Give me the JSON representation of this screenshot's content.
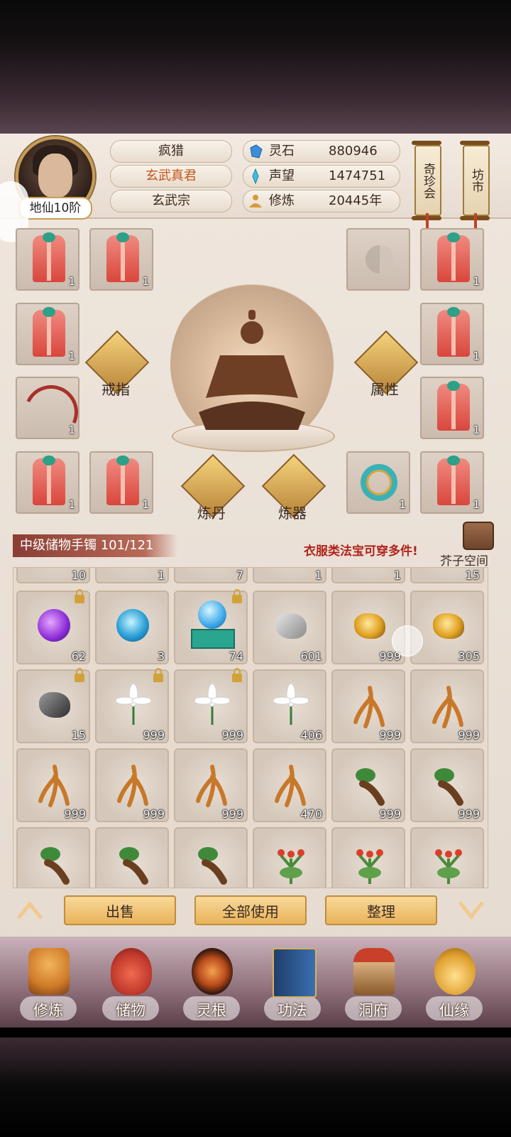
{
  "player": {
    "rank": "地仙10阶",
    "name": "疯猎",
    "title": "玄武真君",
    "sect": "玄武宗"
  },
  "resources": [
    {
      "icon": "spirit-stone-icon",
      "label": "灵石",
      "value": "880946",
      "color": "#3a8fd8"
    },
    {
      "icon": "reputation-icon",
      "label": "声望",
      "value": "1474751",
      "color": "#3ac0e0"
    },
    {
      "icon": "cultivation-icon",
      "label": "修炼",
      "value": "20445年",
      "color": "#d99a3a"
    }
  ],
  "top_scrolls": [
    "奇珍会",
    "坊市"
  ],
  "equipment": {
    "left_slots": [
      {
        "item": "red-robe",
        "count": "1"
      },
      {
        "item": "red-robe",
        "count": "1"
      },
      {
        "item": "red-robe",
        "count": "1"
      },
      {
        "item": "bow",
        "count": "1"
      },
      {
        "item": "red-robe",
        "count": "1"
      },
      {
        "item": "red-robe",
        "count": "1"
      }
    ],
    "right_slots": [
      {
        "item": "empty",
        "count": ""
      },
      {
        "item": "red-robe",
        "count": "1"
      },
      {
        "item": "red-robe",
        "count": "1"
      },
      {
        "item": "red-robe",
        "count": "1"
      },
      {
        "item": "jade-ring",
        "count": "1"
      },
      {
        "item": "red-robe",
        "count": "1"
      }
    ],
    "buttons": {
      "ring": "戒指",
      "attributes": "属性",
      "alchemy": "炼丹",
      "forging": "炼器"
    }
  },
  "bag": {
    "title": "中级储物手镯 101/121",
    "tip": "衣服类法宝可穿多件!",
    "space_label": "芥子空间",
    "partial_row_counts": [
      "10",
      "1",
      "7",
      "1",
      "1",
      "15"
    ],
    "rows": [
      [
        {
          "item": "purple-orb",
          "count": "62",
          "locked": true
        },
        {
          "item": "blue-orb",
          "count": "3",
          "locked": false
        },
        {
          "item": "jade-pedestal-orb",
          "count": "74",
          "locked": true
        },
        {
          "item": "silver-ore",
          "count": "601",
          "locked": false
        },
        {
          "item": "gold-ore",
          "count": "999",
          "locked": false
        },
        {
          "item": "gold-ore",
          "count": "305",
          "locked": false
        }
      ],
      [
        {
          "item": "dark-ore",
          "count": "15",
          "locked": true
        },
        {
          "item": "white-lily",
          "count": "999",
          "locked": true
        },
        {
          "item": "white-lily",
          "count": "999",
          "locked": true
        },
        {
          "item": "white-lily",
          "count": "406",
          "locked": false
        },
        {
          "item": "ginseng-root",
          "count": "999",
          "locked": false
        },
        {
          "item": "ginseng-root",
          "count": "999",
          "locked": false
        }
      ],
      [
        {
          "item": "ginseng-root",
          "count": "999",
          "locked": false
        },
        {
          "item": "ginseng-root",
          "count": "999",
          "locked": false
        },
        {
          "item": "ginseng-root",
          "count": "999",
          "locked": false
        },
        {
          "item": "ginseng-root",
          "count": "470",
          "locked": false
        },
        {
          "item": "leaf-tuber",
          "count": "999",
          "locked": false
        },
        {
          "item": "leaf-tuber",
          "count": "999",
          "locked": false
        }
      ],
      [
        {
          "item": "leaf-tuber",
          "count": "",
          "locked": false
        },
        {
          "item": "leaf-tuber",
          "count": "",
          "locked": false
        },
        {
          "item": "leaf-tuber",
          "count": "",
          "locked": false
        },
        {
          "item": "red-flower-herb",
          "count": "",
          "locked": false
        },
        {
          "item": "red-flower-herb",
          "count": "",
          "locked": false
        },
        {
          "item": "red-flower-herb",
          "count": "",
          "locked": false
        }
      ]
    ]
  },
  "actions": {
    "sell": "出售",
    "use_all": "全部使用",
    "sort": "整理"
  },
  "nav": [
    {
      "label": "修炼",
      "icon": "cultivator-icon",
      "color": "#d07a2a"
    },
    {
      "label": "储物",
      "icon": "storage-bag-icon",
      "color": "#c0392b"
    },
    {
      "label": "灵根",
      "icon": "spirit-root-icon",
      "color": "#b84a1a"
    },
    {
      "label": "功法",
      "icon": "technique-book-icon",
      "color": "#2f5f9a"
    },
    {
      "label": "洞府",
      "icon": "cave-residence-icon",
      "color": "#8a5a2a"
    },
    {
      "label": "仙缘",
      "icon": "gourd-icon",
      "color": "#e0a030"
    }
  ]
}
